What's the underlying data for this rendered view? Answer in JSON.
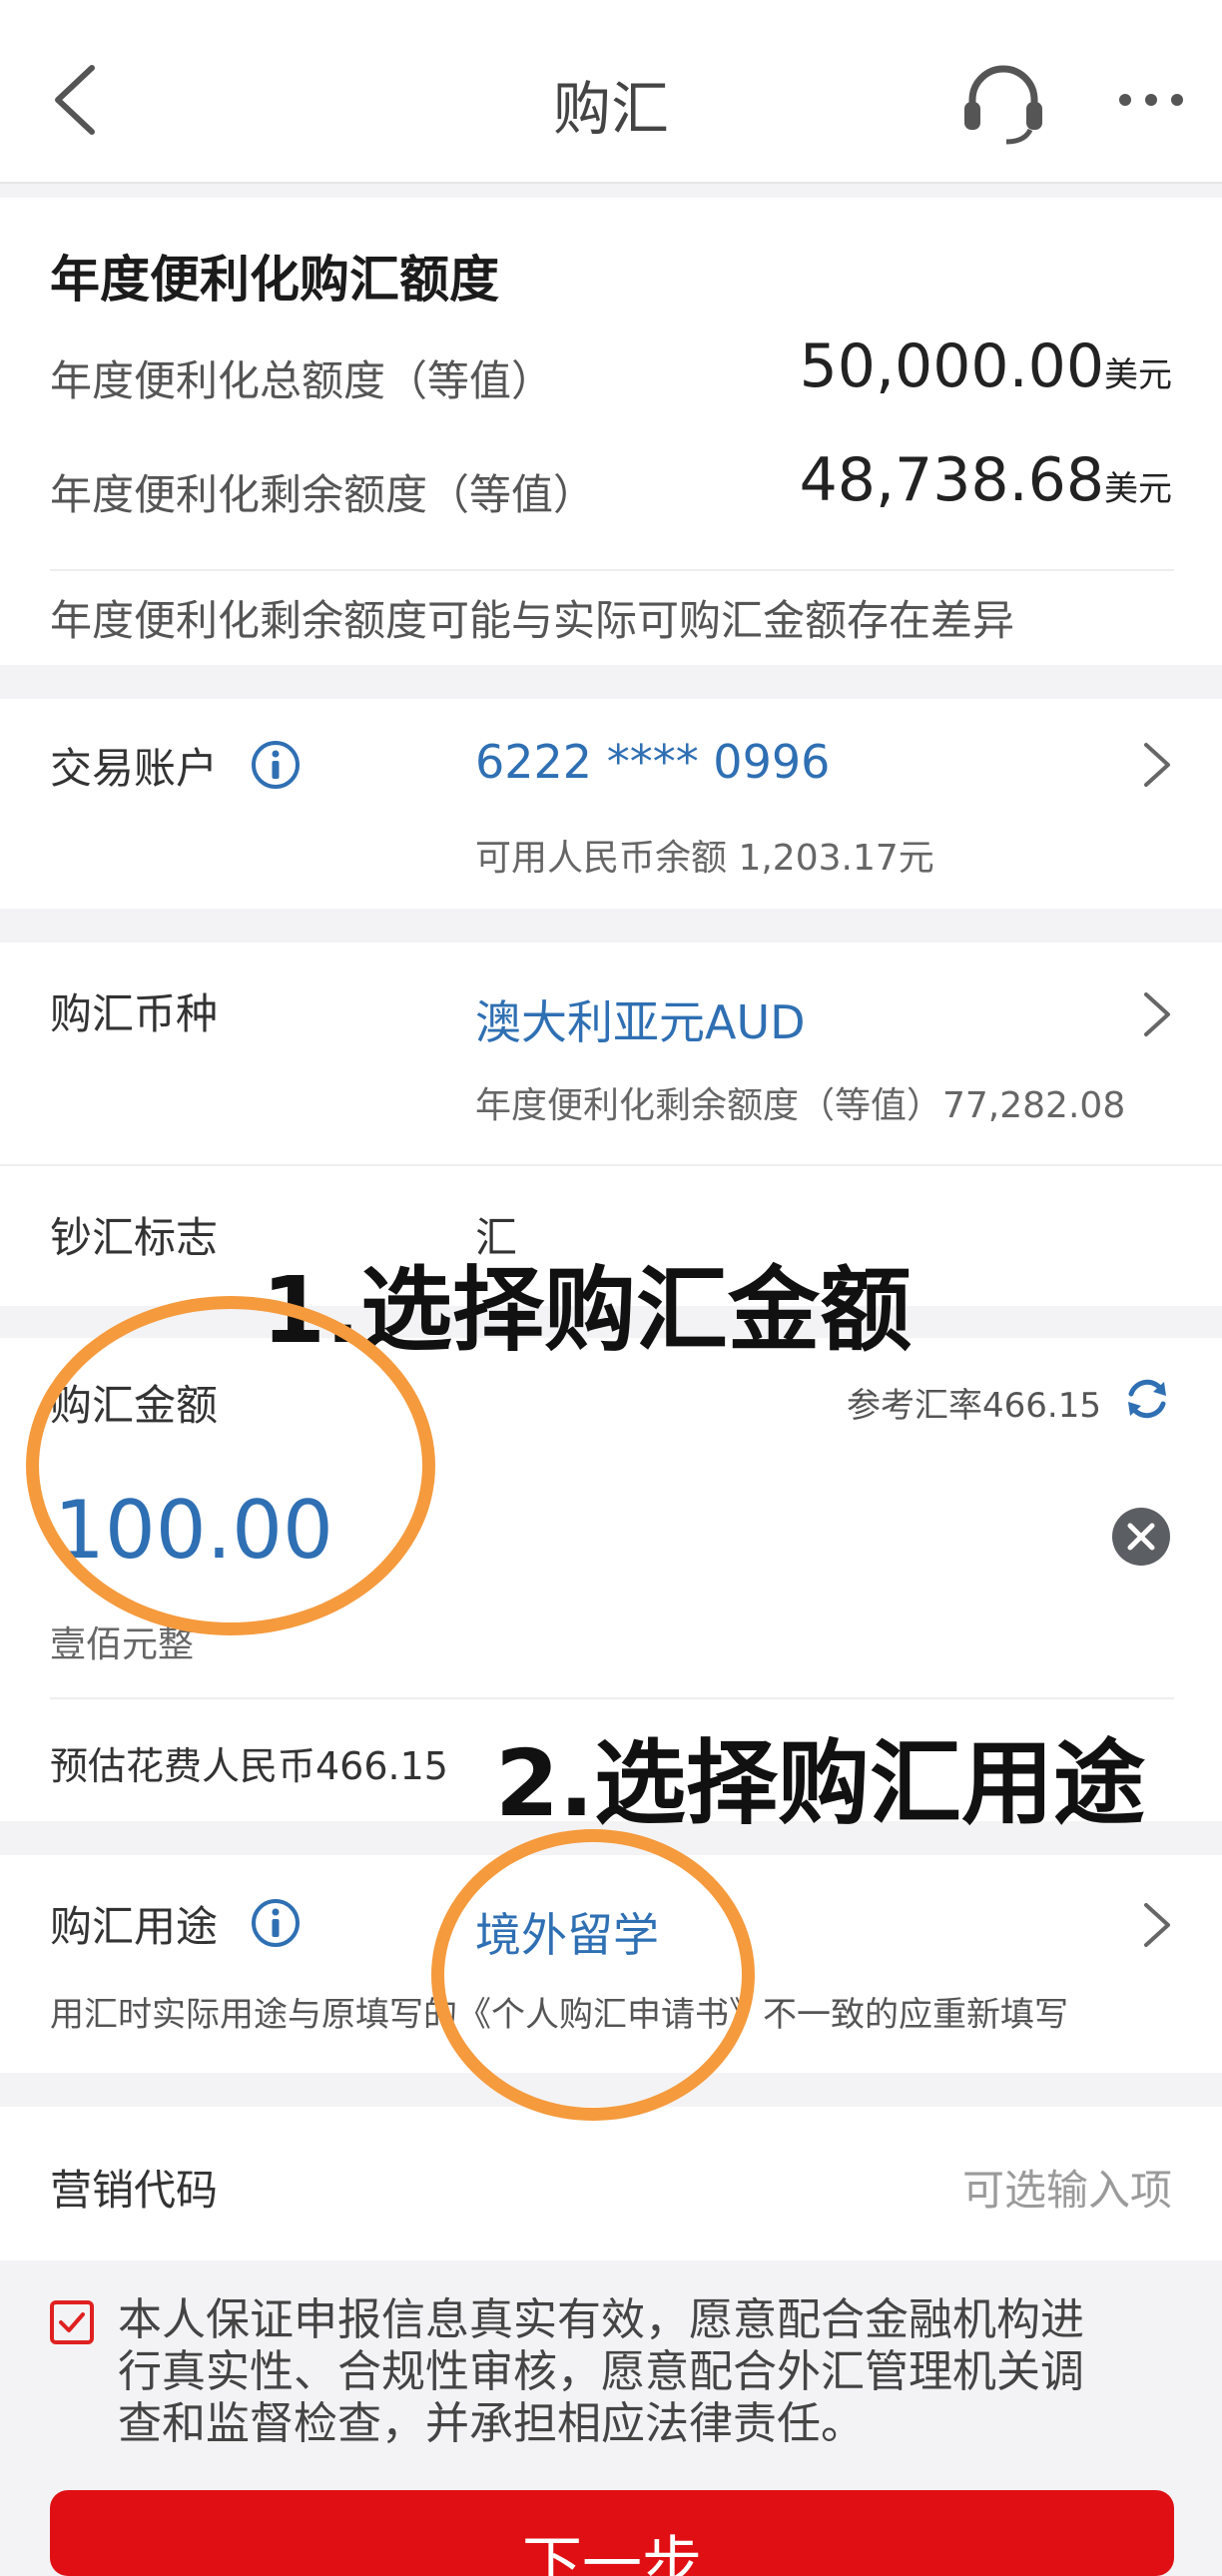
{
  "header": {
    "title": "购汇"
  },
  "quota": {
    "title": "年度便利化购汇额度",
    "total_label": "年度便利化总额度（等值）",
    "total_value": "50,000.00",
    "total_unit": "美元",
    "remain_label": "年度便利化剩余额度（等值）",
    "remain_value": "48,738.68",
    "remain_unit": "美元",
    "note": "年度便利化剩余额度可能与实际可购汇金额存在差异"
  },
  "account": {
    "label": "交易账户",
    "number": "6222 **** 0996",
    "balance": "可用人民币余额 1,203.17元"
  },
  "currency": {
    "label": "购汇币种",
    "value": "澳大利亚元AUD",
    "remain": "年度便利化剩余额度（等值）77,282.08"
  },
  "cash_flag": {
    "label": "钞汇标志",
    "value": "汇"
  },
  "amount": {
    "label": "购汇金额",
    "rate": "参考汇率466.15",
    "value": "100.00",
    "chinese": "壹佰元整",
    "estimate": "预估花费人民币466.15"
  },
  "purpose": {
    "label": "购汇用途",
    "value": "境外留学",
    "note": "用汇时实际用途与原填写的《个人购汇申请书》不一致的应重新填写"
  },
  "marketing": {
    "label": "营销代码",
    "placeholder": "可选输入项"
  },
  "declaration": {
    "line1": "本人保证申报信息真实有效，愿意配合金融机构进",
    "line2": "行真实性、合规性审核，愿意配合外汇管理机关调",
    "line3": "查和监督检查，并承担相应法律责任。"
  },
  "next_button": "下一步",
  "annotations": {
    "step1": "1.选择购汇金额",
    "step2": "2.选择购汇用途"
  },
  "colors": {
    "accent": "#2f6fb3",
    "button": "#e00f14",
    "annotation_circle": "#f59a3d"
  }
}
